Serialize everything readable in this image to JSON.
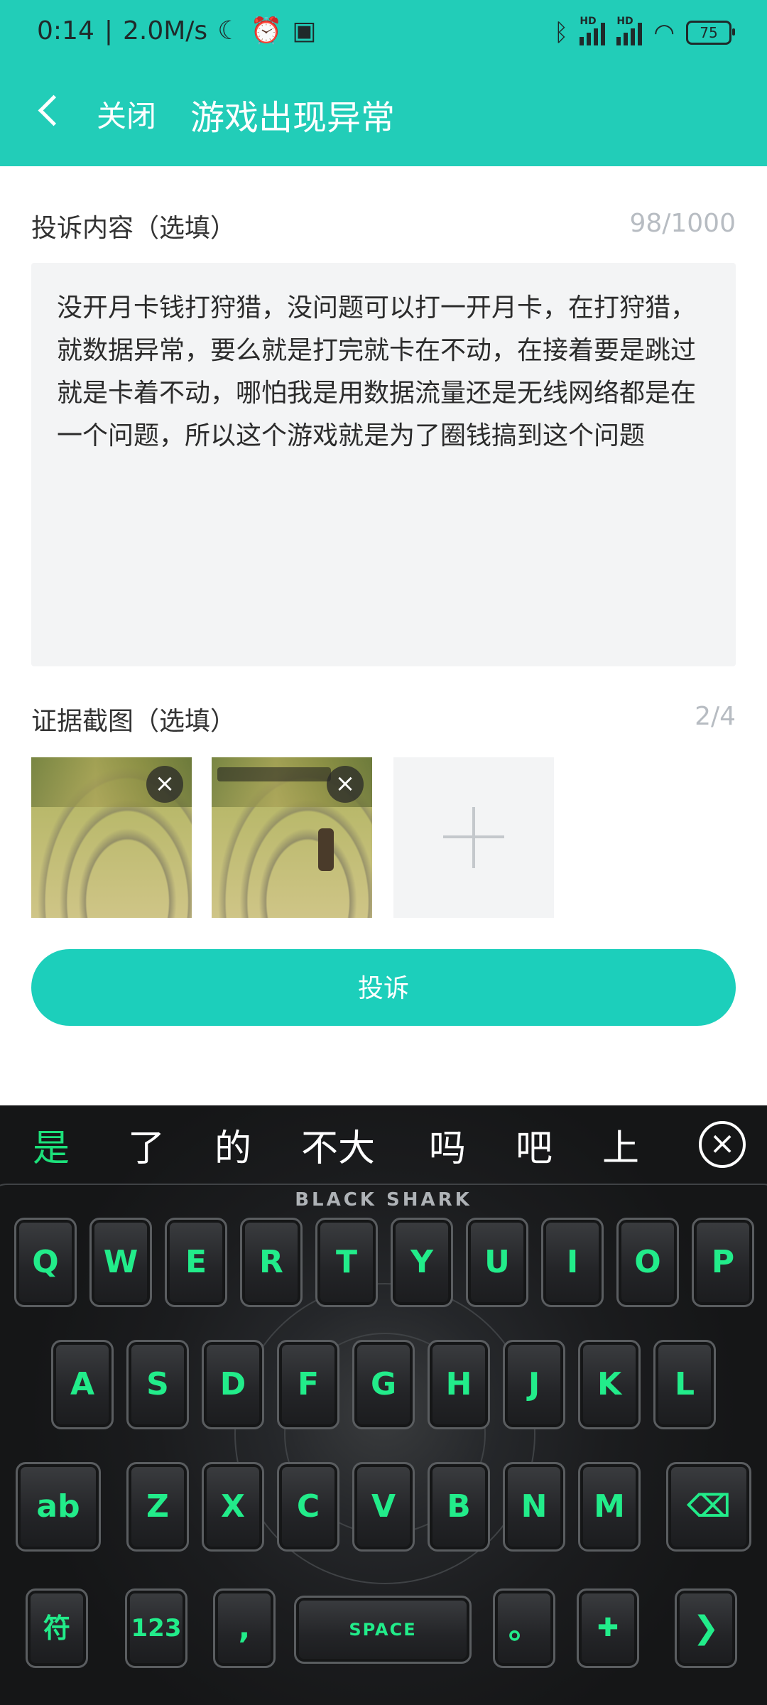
{
  "status_bar": {
    "time": "0:14",
    "speed": "2.0M/s",
    "battery": "75",
    "hd": "HD"
  },
  "nav": {
    "close_label": "关闭",
    "title": "游戏出现异常"
  },
  "complaint": {
    "label": "投诉内容（选填）",
    "counter": "98/1000",
    "text": "没开月卡钱打狩猎，没问题可以打一开月卡，在打狩猎，就数据异常，要么就是打完就卡在不动，在接着要是跳过就是卡着不动，哪怕我是用数据流量还是无线网络都是在一个问题，所以这个游戏就是为了圈钱搞到这个问题"
  },
  "evidence": {
    "label": "证据截图（选填）",
    "counter": "2/4",
    "close_glyph": "×"
  },
  "submit_label": "投诉",
  "keyboard": {
    "candidates": [
      "是",
      "了",
      "的",
      "不大",
      "吗",
      "吧",
      "上"
    ],
    "close_glyph": "×",
    "brand": "BLACK SHARK",
    "row1": [
      "Q",
      "W",
      "E",
      "R",
      "T",
      "Y",
      "U",
      "I",
      "O",
      "P"
    ],
    "row2": [
      "A",
      "S",
      "D",
      "F",
      "G",
      "H",
      "J",
      "K",
      "L"
    ],
    "row3": [
      "Z",
      "X",
      "C",
      "V",
      "B",
      "N",
      "M"
    ],
    "shift_label": "ab",
    "backspace_glyph": "⌫",
    "symbol_label": "符",
    "number_label": "123",
    "comma_label": ",",
    "space_label": "SPACE",
    "period_label": "。",
    "emoji_glyph": "✚",
    "enter_glyph": "❯"
  },
  "colors": {
    "header": "#22cdb8",
    "accent": "#1ccfbb",
    "key_text": "#22ec8a"
  }
}
